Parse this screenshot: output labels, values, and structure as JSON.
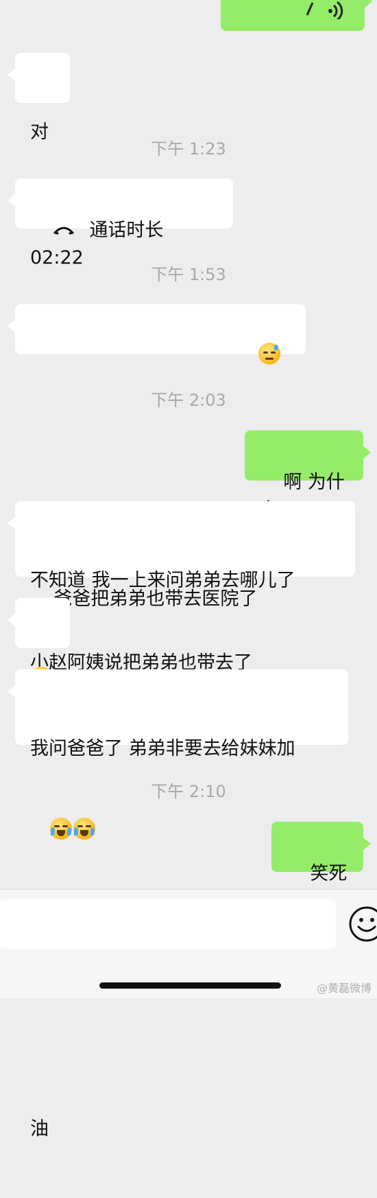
{
  "colors": {
    "background": "#ededed",
    "bubble_left": "#ffffff",
    "bubble_right": "#95ec69",
    "timestamp": "#a8a8a8"
  },
  "messages": {
    "m0": {
      "side": "right",
      "type": "voice",
      "icon": "voice-wave-icon"
    },
    "m1": {
      "side": "left",
      "text": "对"
    },
    "t1": "下午 1:23",
    "m2": {
      "side": "left",
      "type": "call",
      "icon": "phone-hangup-icon",
      "text": "通话时长 02:22"
    },
    "t2": "下午 1:53",
    "m3": {
      "side": "left",
      "text": "爸爸把弟弟也带去医院了",
      "emoji": "sweat-face-emoji"
    },
    "t3": "下午 2:03",
    "m4": {
      "side": "right",
      "text": "啊 为什么"
    },
    "m5": {
      "side": "left",
      "line1": "不知道 我一上来问弟弟去哪儿了",
      "line2": "小赵阿姨说把弟弟也带去了"
    },
    "m6": {
      "side": "left",
      "emoji": "yawning-face-emoji"
    },
    "m7": {
      "side": "left",
      "line1": "我问爸爸了 弟弟非要去给妹妹加",
      "line2": "油",
      "emoji": "crying-face-emoji"
    },
    "t4": "下午 2:10",
    "m8": {
      "side": "right",
      "text": "笑死了"
    }
  },
  "input": {
    "value": "",
    "placeholder": ""
  },
  "watermark": "@黄磊微博"
}
